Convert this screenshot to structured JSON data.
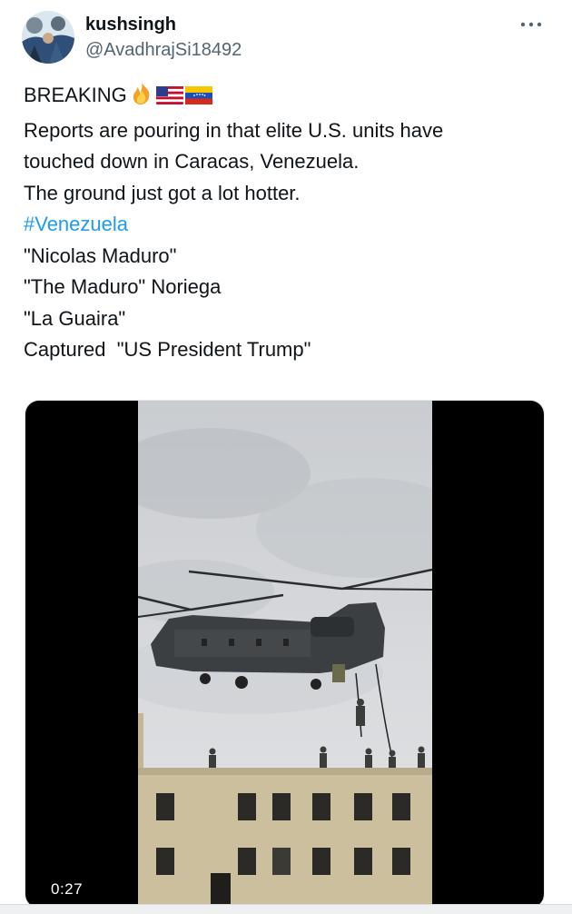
{
  "user": {
    "display_name": "kushsingh",
    "handle": "@AvadhrajSi18492"
  },
  "tweet": {
    "lines": [
      "BREAKING",
      "Reports are pouring in that elite U.S. units have",
      "touched down in Caracas, Venezuela.",
      "The ground just got a lot hotter.",
      "#Venezuela",
      "\"Nicolas Maduro\"",
      "\"The Maduro\" Noriega",
      "\"La Guaira\"",
      "Captured  \"US President Trump\""
    ],
    "emojis": [
      "fire-emoji",
      "us-flag-emoji",
      "venezuela-flag-emoji"
    ]
  },
  "media": {
    "type": "video",
    "duration": "0:27"
  },
  "colors": {
    "hashtag": "#1d9bf0",
    "secondary_text": "#536471",
    "text": "#0f1419"
  },
  "icons": [
    "more-options-icon",
    "avatar"
  ]
}
